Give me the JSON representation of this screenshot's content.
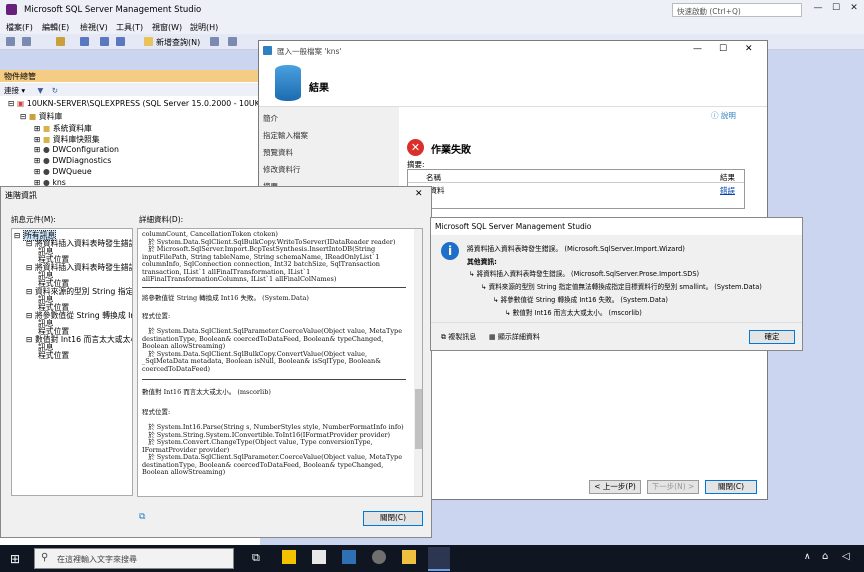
{
  "ssms": {
    "title": "Microsoft SQL Server Management Studio",
    "quick_launch": "快速啟動 (Ctrl+Q)",
    "menu": [
      "檔案(F)",
      "編輯(E)",
      "檢視(V)",
      "工具(T)",
      "視窗(W)",
      "說明(H)"
    ],
    "toolbar_new_query": "新增查詢(N)",
    "object_explorer": {
      "header": "物件總管",
      "connect": "連接 ▾",
      "server": "10UKN-SERVER\\SQLEXPRESS (SQL Server 15.0.2000 - 10UKN-SE",
      "databases": "資料庫",
      "items": [
        "系統資料庫",
        "資料庫快照集",
        "DWConfiguration",
        "DWDiagnostics",
        "DWQueue",
        "kns"
      ]
    }
  },
  "wizard": {
    "title": "匯入一般檔案 'kns'",
    "heading": "結果",
    "help": "說明",
    "nav": [
      "簡介",
      "指定輸入檔案",
      "預覽資料",
      "修改資料行",
      "摘要",
      "結果"
    ],
    "status": "作業失敗",
    "summary_label": "摘要:",
    "table_headers": [
      "名稱",
      "結果"
    ],
    "table_rows": [
      {
        "name": "入資料",
        "result": "錯誤"
      }
    ],
    "btn_prev": "< 上一步(P)",
    "btn_next": "下一步(N) >",
    "btn_close": "關閉(C)"
  },
  "details": {
    "title": "進階資訊",
    "tree_label": "訊息元件(M):",
    "detail_label": "詳細資料(D):",
    "tree": [
      {
        "text": "所有訊息",
        "level": 0,
        "selected": true
      },
      {
        "text": "將資料插入資料表時發生錯誤",
        "level": 1
      },
      {
        "text": "訊息",
        "level": 2
      },
      {
        "text": "程式位置",
        "level": 2
      },
      {
        "text": "將資料插入資料表時發生錯誤",
        "level": 1
      },
      {
        "text": "訊息",
        "level": 2
      },
      {
        "text": "程式位置",
        "level": 2
      },
      {
        "text": "資料來源的型別 String 指定值",
        "level": 1
      },
      {
        "text": "訊息",
        "level": 2
      },
      {
        "text": "程式位置",
        "level": 2
      },
      {
        "text": "將參數值從 String 轉換成 Int1",
        "level": 1
      },
      {
        "text": "訊息",
        "level": 2
      },
      {
        "text": "程式位置",
        "level": 2
      },
      {
        "text": "數值對 Int16 而言太大或太小",
        "level": 1
      },
      {
        "text": "訊息",
        "level": 2
      },
      {
        "text": "程式位置",
        "level": 2
      }
    ],
    "detail_blocks": [
      "columnCount, CancellationToken ctoken)\n   於 System.Data.SqlClient.SqlBulkCopy.WriteToServer(IDataReader reader)\n   於 Microsoft.SqlServer.Import.BcpTestSynthesis.InsertIntoDB(String inputFilePath, String tableName, String schemaName, IReadOnlyList`1 columnInfo, SqlConnection connection, Int32 batchSize, SqlTransaction transaction, IList`1 allFinalTransformation, IList`1 allFinalTransformationColumns, IList`1 allFinalColNames)",
      "將參數值從 String 轉換成 Int16 失敗。 (System.Data)",
      "程式位置:\n\n   於 System.Data.SqlClient.SqlParameter.CoerceValue(Object value, MetaType destinationType, Boolean& coercedToDataFeed, Boolean& typeChanged, Boolean allowStreaming)\n   於 System.Data.SqlClient.SqlBulkCopy.ConvertValue(Object value, _SqlMetaData metadata, Boolean isNull, Boolean& isSqlType, Boolean& coercedToDataFeed)",
      "數值對 Int16 而言太大或太小。 (mscorlib)",
      "程式位置:\n\n   於 System.Int16.Parse(String s, NumberStyles style, NumberFormatInfo info)\n   於 System.String.System.IConvertible.ToInt16(IFormatProvider provider)\n   於 System.Convert.ChangeType(Object value, Type conversionType, IFormatProvider provider)\n   於 System.Data.SqlClient.SqlParameter.CoerceValue(Object value, MetaType destinationType, Boolean& coercedToDataFeed, Boolean& typeChanged, Boolean allowStreaming)"
    ],
    "btn_close": "關閉(C)"
  },
  "msgbox": {
    "title": "Microsoft SQL Server Management Studio",
    "line1": "將資料插入資料表時發生錯誤。 (Microsoft.SqlServer.Import.Wizard)",
    "other_info": "其他資訊:",
    "chain": [
      "將資料插入資料表時發生錯誤。 (Microsoft.SqlServer.Prose.Import.SDS)",
      "資料來源的型別 String 指定值無法轉換成指定目標資料行的型別 smallint。 (System.Data)",
      "將參數值從 String 轉換成 Int16 失敗。 (System.Data)",
      "數值對 Int16 而言太大或太小。 (mscorlib)"
    ],
    "copy_msg": "複製訊息",
    "show_details": "顯示詳細資料",
    "ok": "確定"
  },
  "taskbar": {
    "search_placeholder": "在這裡輸入文字來搜尋"
  },
  "colors": {
    "accent": "#0078d7",
    "error": "#d9302b",
    "oe_header": "#f5cc84"
  }
}
